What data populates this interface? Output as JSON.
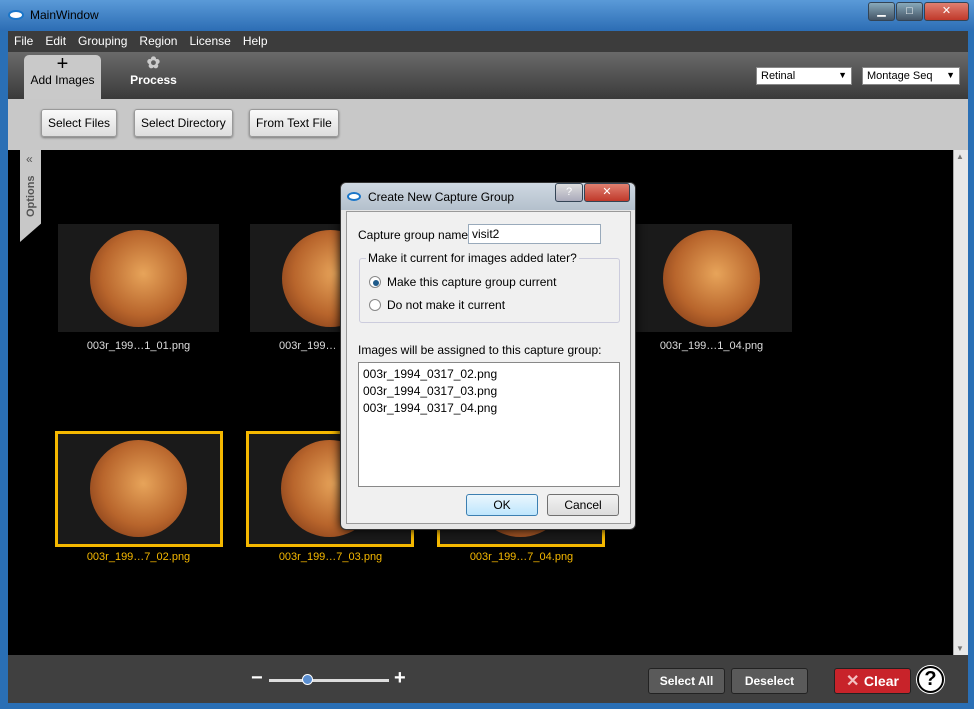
{
  "window": {
    "title": "MainWindow",
    "minimize": "▁",
    "maximize": "□",
    "close": "✕"
  },
  "menu": [
    "File",
    "Edit",
    "Grouping",
    "Region",
    "License",
    "Help"
  ],
  "toolbar": {
    "tabs": [
      {
        "label": "Add Images",
        "icon": "plus-icon",
        "active": true
      },
      {
        "label": "Process",
        "icon": "gear-icon",
        "active": false
      }
    ],
    "dropdowns": [
      {
        "value": "Retinal"
      },
      {
        "value": "Montage Seq"
      }
    ]
  },
  "buttons": {
    "select_files": "Select Files",
    "select_directory": "Select Directory",
    "from_text_file": "From Text File"
  },
  "options_tab": {
    "label": "Options",
    "chevron": "«"
  },
  "thumbnails": [
    {
      "label": "003r_199…1_01.png",
      "selected": false
    },
    {
      "label": "003r_199…",
      "selected": false
    },
    {
      "label": "",
      "selected": false
    },
    {
      "label": "003r_199…1_04.png",
      "selected": false
    },
    {
      "label": "003r_199…7_02.png",
      "selected": true
    },
    {
      "label": "003r_199…7_03.png",
      "selected": true
    },
    {
      "label": "003r_199…7_04.png",
      "selected": true
    }
  ],
  "bottom": {
    "zoom_minus": "−",
    "zoom_plus": "+",
    "zoom_level": 0.3,
    "select_all": "Select All",
    "deselect": "Deselect",
    "clear": "Clear",
    "help": "?"
  },
  "dialog": {
    "title": "Create New Capture Group",
    "help": "?",
    "close": "✕",
    "name_label": "Capture group name:",
    "name_value": "visit2",
    "group_label": "Make it current for images added later?",
    "radio1": "Make this capture group current",
    "radio2": "Do not make it current",
    "selected_radio": 1,
    "list_label": "Images will be assigned to this capture group:",
    "files": [
      "003r_1994_0317_02.png",
      "003r_1994_0317_03.png",
      "003r_1994_0317_04.png"
    ],
    "ok": "OK",
    "cancel": "Cancel"
  },
  "colors": {
    "selection": "#f5b800",
    "clear": "#c8232a"
  }
}
